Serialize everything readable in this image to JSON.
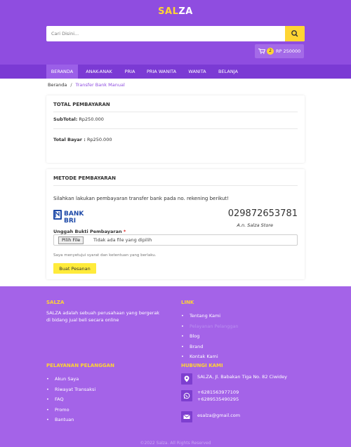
{
  "header": {
    "logo_part1": "SAL",
    "logo_part2": "ZA",
    "search_placeholder": "Cari Disini...",
    "cart_count": "2",
    "cart_total": "RP 250000"
  },
  "nav": {
    "items": [
      "BERANDA",
      "ANAK-ANAK",
      "PRIA",
      "PRIA WANITA",
      "WANITA",
      "BELANJA"
    ],
    "active": "BERANDA"
  },
  "breadcrumb": {
    "home": "Beranda",
    "separator": "/",
    "current": "Transfer Bank Manual"
  },
  "total_section": {
    "title": "TOTAL PEMBAYARAN",
    "subtotal_label": "SubTotal:",
    "subtotal_value": "Rp250.000",
    "total_label": "Total Bayar :",
    "total_value": "Rp250.000"
  },
  "payment_section": {
    "title": "METODE PEMBAYARAN",
    "instruction": "Silahkan lakukan pembayaran transfer bank pada no. rekening berikut!",
    "bank_name": "BANK BRI",
    "account_number": "029872653781",
    "account_holder": "A.n. Salza Store",
    "upload_label": "Unggah Bukti Pembayaran",
    "required_mark": "*",
    "file_button": "Pilih File",
    "file_status": "Tidak ada file yang dipilih",
    "agreement": "Saya menyetujui syarat dan ketentuan yang berlaku.",
    "order_button": "Buat Pesanan"
  },
  "footer": {
    "about_title": "SALZA",
    "about_text": "SALZA adalah sebuah perusahaan yang bergerak di bidang jual beli secara online",
    "link_title": "LINK",
    "links": [
      "Tentang Kami",
      "Pelayanan Pelanggan",
      "Blog",
      "Brand",
      "Kontak Kami"
    ],
    "service_title": "PELAYANAN PELANGGAN",
    "services": [
      "Akun Saya",
      "Riwayat Transaksi",
      "FAQ",
      "Promo",
      "Bantuan"
    ],
    "contact_title": "HUBUNGI KAMI",
    "address": "SALZA, Jl. Babakan Tiga No. 82 Ciwidey",
    "phone1": "+6281563977109",
    "phone2": "+6289535490295",
    "email": "esalza@gmail.com",
    "copyright": "©2022 Salza. All Rights Reserved"
  },
  "colors": {
    "header_purple": "#8f4de0",
    "nav_purple": "#7b3ad4",
    "footer_purple": "#a463e8",
    "accent_yellow": "#ffd533",
    "bri_blue": "#1f4aa8"
  },
  "icons": {
    "search": "search-icon",
    "cart": "cart-icon",
    "location": "map-marker-icon",
    "whatsapp": "whatsapp-icon",
    "email": "envelope-icon"
  }
}
